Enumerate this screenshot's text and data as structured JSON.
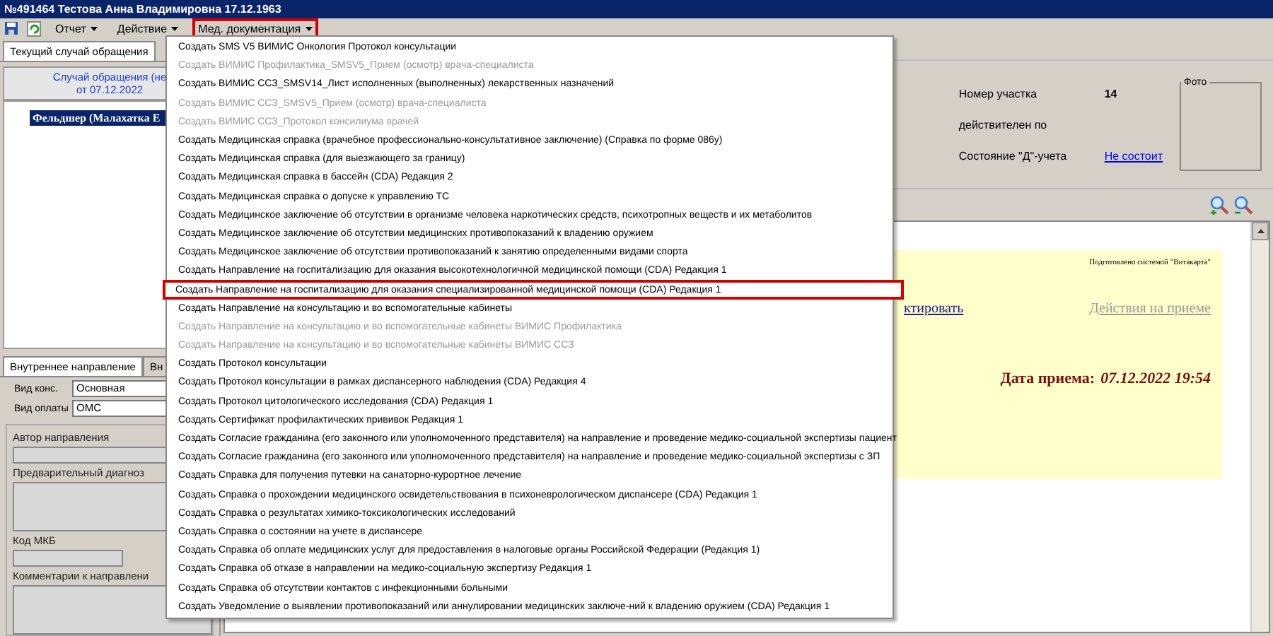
{
  "window": {
    "title": "№491464 Тестова Анна Владимировна 17.12.1963"
  },
  "toolbar": {
    "menus": [
      {
        "label": "Отчет",
        "outlined": false
      },
      {
        "label": "Действие",
        "outlined": false
      },
      {
        "label": "Мед. документация",
        "outlined": true
      }
    ]
  },
  "left_panel": {
    "tabs": [
      {
        "label": "Текущий случай обращения",
        "selected": true
      }
    ],
    "case_header": [
      "Случай обращения (не",
      "от 07.12.2022"
    ],
    "tree": [
      {
        "label": "Фельдшер (Малахатка Е",
        "selected": true
      }
    ]
  },
  "referral": {
    "tabs": [
      {
        "label": "Внутреннее направление",
        "selected": true
      },
      {
        "label": "Вн",
        "selected": false
      }
    ],
    "fields": [
      {
        "label": "Вид конс.",
        "value": "Основная"
      },
      {
        "label": "Вид оплаты",
        "value": "ОМС"
      }
    ],
    "sections": [
      {
        "label": "Автор направления",
        "kind": "line"
      },
      {
        "label": "Предварительный диагноз",
        "kind": "area"
      },
      {
        "label": "Код МКБ",
        "kind": "short"
      },
      {
        "label": "Комментарии к направлени",
        "kind": "area"
      }
    ]
  },
  "patient_info": {
    "rows": [
      {
        "label": "Номер участка",
        "value": "14",
        "kind": "bold"
      },
      {
        "label": "действителен по"
      },
      {
        "label": "Состояние \"Д\"-учета",
        "value": "Не состоит",
        "kind": "link"
      }
    ],
    "photo_label": "Фото"
  },
  "document": {
    "prepared_by": "Подготовлено системой \"Витакарта\"",
    "edit_link": "ктировать",
    "actions_link": {
      "label": "Действия на приеме",
      "disabled": true
    },
    "date_label": "Дата приема:",
    "date_value": "07.12.2022 19:54"
  },
  "dropdown": {
    "items": [
      {
        "label": "Создать SMS V5 ВИМИС Онкология Протокол консультации",
        "disabled": false,
        "outlined": false
      },
      {
        "label": "Создать ВИМИС Профилактика_SMSV5_Прием (осмотр) врача-специалиста",
        "disabled": true,
        "outlined": false
      },
      {
        "label": "Создать ВИМИС ССЗ_SMSV14_Лист исполненных (выполненных) лекарственных назначений",
        "disabled": false,
        "outlined": false
      },
      {
        "label": "Создать ВИМИС ССЗ_SMSV5_Прием (осмотр) врача-специалиста",
        "disabled": true,
        "outlined": false
      },
      {
        "label": "Создать ВИМИС ССЗ_Протокол консилиума врачей",
        "disabled": true,
        "outlined": false
      },
      {
        "label": "Создать Медицинская справка (врачебное профессионально-консультативное заключение) (Справка по форме 086у)",
        "disabled": false,
        "outlined": false
      },
      {
        "label": "Создать Медицинская справка (для выезжающего за границу)",
        "disabled": false,
        "outlined": false
      },
      {
        "label": "Создать Медицинская справка в бассейн (CDA) Редакция 2",
        "disabled": false,
        "outlined": false
      },
      {
        "label": "Создать Медицинская справка о допуске к управлению ТС",
        "disabled": false,
        "outlined": false
      },
      {
        "label": "Создать Медицинское заключение об отсутствии в организме человека наркотических средств, психотропных веществ и их метаболитов",
        "disabled": false,
        "outlined": false
      },
      {
        "label": "Создать Медицинское заключение об отсутствии медицинских противопоказаний к владению оружием",
        "disabled": false,
        "outlined": false
      },
      {
        "label": "Создать Медицинское заключение об отсутствии противопоказаний к занятию определенными видами спорта",
        "disabled": false,
        "outlined": false
      },
      {
        "label": "Создать Направление на госпитализацию для оказания высокотехнологичной медицинской помощи (CDA) Редакция 1",
        "disabled": false,
        "outlined": false
      },
      {
        "label": "Создать Направление на госпитализацию для оказания специализированной медицинской помощи (CDA) Редакция 1",
        "disabled": false,
        "outlined": true
      },
      {
        "label": "Создать Направление на консультацию и во вспомогательные кабинеты",
        "disabled": false,
        "outlined": false
      },
      {
        "label": "Создать Направление на консультацию и во вспомогательные кабинеты ВИМИС Профилактика",
        "disabled": true,
        "outlined": false
      },
      {
        "label": "Создать Направление на консультацию и во вспомогательные кабинеты ВИМИС ССЗ",
        "disabled": true,
        "outlined": false
      },
      {
        "label": "Создать Протокол консультации",
        "disabled": false,
        "outlined": false
      },
      {
        "label": "Создать Протокол консультации в рамках диспансерного наблюдения (CDA) Редакция 4",
        "disabled": false,
        "outlined": false
      },
      {
        "label": "Создать Протокол цитологического исследования (CDA) Редакция 1",
        "disabled": false,
        "outlined": false
      },
      {
        "label": "Создать Сертификат профилактических прививок Редакция 1",
        "disabled": false,
        "outlined": false
      },
      {
        "label": "Создать Согласие гражданина (его законного или уполномоченного представителя) на направление и проведение медико-социальной экспертизы пациент",
        "disabled": false,
        "outlined": false
      },
      {
        "label": "Создать Согласие гражданина (его законного или уполномоченного представителя) на направление и проведение медико-социальной экспертизы с ЗП",
        "disabled": false,
        "outlined": false
      },
      {
        "label": "Создать Справка для получения путевки на санаторно-курортное лечение",
        "disabled": false,
        "outlined": false
      },
      {
        "label": "Создать Справка о прохождении медицинского освидетельствования в психоневрологическом диспансере (CDA) Редакция 1",
        "disabled": false,
        "outlined": false
      },
      {
        "label": "Создать Справка о результатах химико-токсикологических исследований",
        "disabled": false,
        "outlined": false
      },
      {
        "label": "Создать Справка о состоянии на учете в диспансере",
        "disabled": false,
        "outlined": false
      },
      {
        "label": "Создать Справка об оплате медицинских услуг для предоставления в налоговые органы Российской Федерации (Редакция 1)",
        "disabled": false,
        "outlined": false
      },
      {
        "label": "Создать Справка об отказе в направлении на медико-социальную экспертизу Редакция 1",
        "disabled": false,
        "outlined": false
      },
      {
        "label": "Создать Справка об отсутствии контактов с инфекционными больными",
        "disabled": false,
        "outlined": false
      },
      {
        "label": "Создать Уведомление о выявлении противопоказаний или аннулировании медицинских заключе-ний к владению оружием (CDA) Редакция 1",
        "disabled": false,
        "outlined": false
      }
    ]
  }
}
